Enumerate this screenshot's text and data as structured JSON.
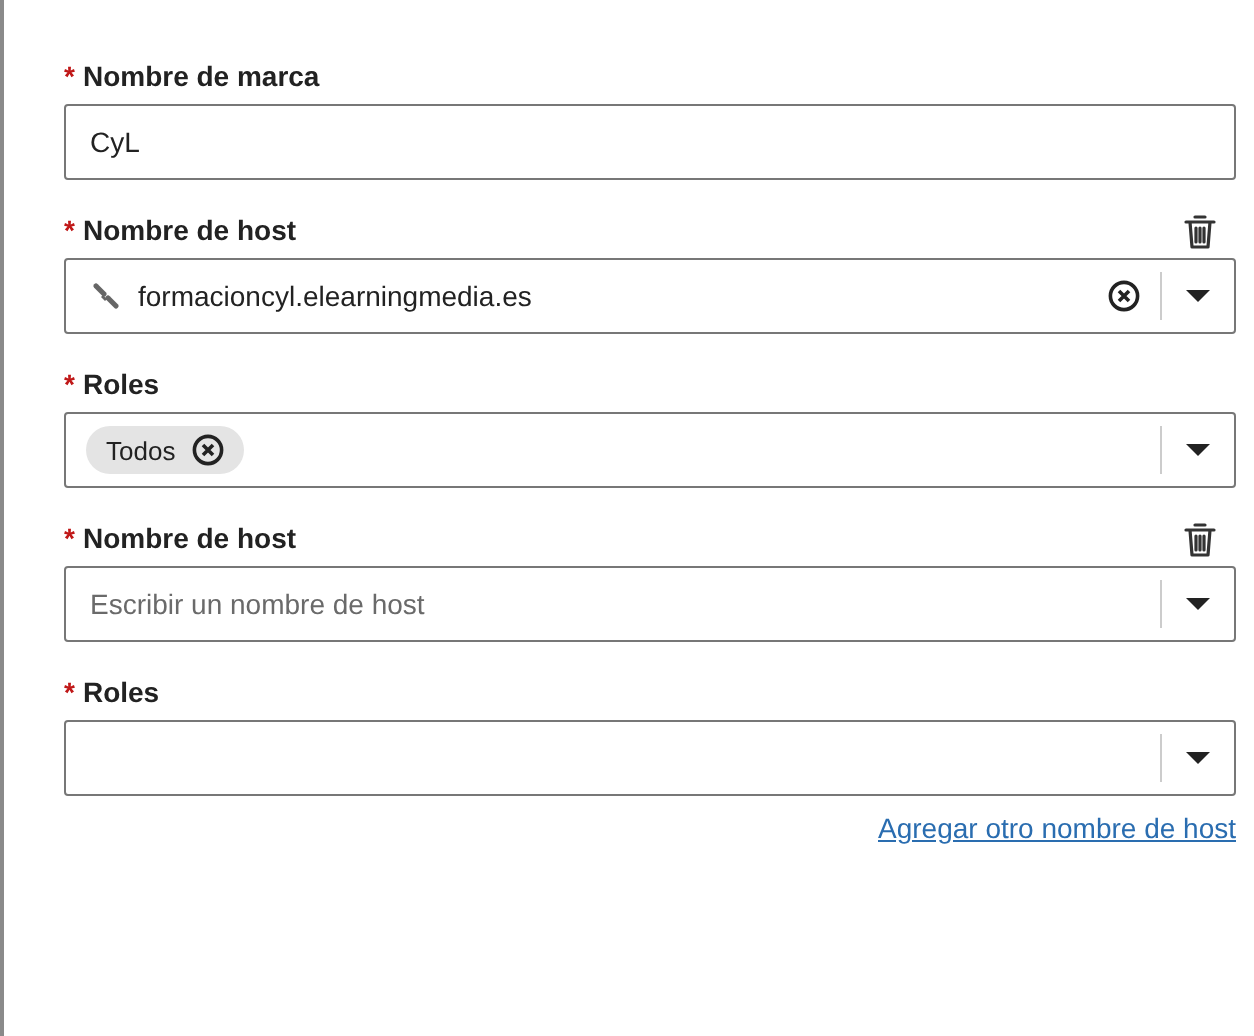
{
  "required_mark": "*",
  "brand": {
    "label": "Nombre de marca",
    "required": true,
    "value": "CyL"
  },
  "hosts": [
    {
      "host": {
        "label": "Nombre de host",
        "required": true,
        "value": "formacioncyl.elearningmedia.es"
      },
      "roles": {
        "label": "Roles",
        "required": true,
        "chips": [
          {
            "label": "Todos"
          }
        ]
      }
    },
    {
      "host": {
        "label": "Nombre de host",
        "required": true,
        "placeholder": "Escribir un nombre de host"
      },
      "roles": {
        "label": "Roles",
        "required": true
      }
    }
  ],
  "add_link": "Agregar otro nombre de host"
}
